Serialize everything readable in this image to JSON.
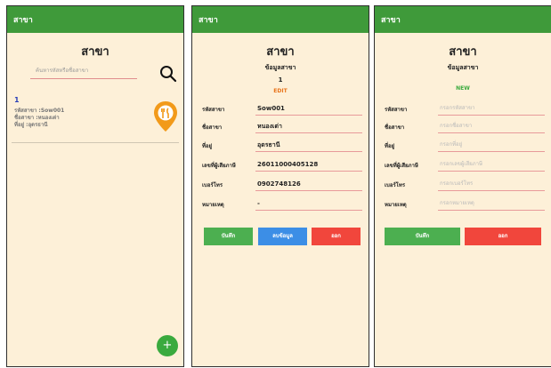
{
  "screen1": {
    "appbar_title": "สาขา",
    "title": "สาขา",
    "search_placeholder": "ค้นหารหัสหรือชื่อสาขา",
    "branches": [
      {
        "index": "1",
        "code_line": "รหัสสาขา :Sow001",
        "name_line": "ชื่อสาขา :หนองเต่า",
        "address_line": "ที่อยู่ :อุดรธานี"
      }
    ],
    "fab_label": "+"
  },
  "screen2": {
    "appbar_title": "สาขา",
    "title": "สาขา",
    "subtitle": "ข้อมูลสาขา",
    "page_number": "1",
    "mode": "EDIT",
    "fields": [
      {
        "label": "รหัสสาขา",
        "value": "Sow001"
      },
      {
        "label": "ชื่อสาขา",
        "value": "หนองเต่า"
      },
      {
        "label": "ที่อยู่",
        "value": "อุดรธานี"
      },
      {
        "label": "เลขที่ผู้เสียภาษี",
        "value": "26011000405128"
      },
      {
        "label": "เบอร์โทร",
        "value": "0902748126"
      },
      {
        "label": "หมายเหตุ",
        "value": "-"
      }
    ],
    "buttons": {
      "save": "บันทึก",
      "delete": "ลบข้อมูล",
      "exit": "ออก"
    }
  },
  "screen3": {
    "appbar_title": "สาขา",
    "title": "สาขา",
    "subtitle": "ข้อมูลสาขา",
    "mode": "NEW",
    "fields": [
      {
        "label": "รหัสสาขา",
        "placeholder": "กรอกรหัสสาขา"
      },
      {
        "label": "ชื่อสาขา",
        "placeholder": "กรอกชื่อสาขา"
      },
      {
        "label": "ที่อยู่",
        "placeholder": "กรอกที่อยู่"
      },
      {
        "label": "เลขที่ผู้เสียภาษี",
        "placeholder": "กรอกเลขผู้เสียภาษี"
      },
      {
        "label": "เบอร์โทร",
        "placeholder": "กรอกเบอร์โทร"
      },
      {
        "label": "หมายเหตุ",
        "placeholder": "กรอกหมายเหตุ"
      }
    ],
    "buttons": {
      "save": "บันทึก",
      "exit": "ออก"
    }
  },
  "colors": {
    "appbar": "#3f9a3a",
    "background": "#fdf0d8",
    "index": "#2a3fb8",
    "edit_mode": "#e8731a",
    "new_mode": "#3aaa3e",
    "pin": "#f29a1a",
    "green_button": "#4caf50",
    "blue_button": "#3c8ee6",
    "red_button": "#f1463c"
  },
  "icons": {
    "search": "search-icon",
    "restaurant_pin": "restaurant-pin-icon",
    "add": "plus-icon"
  }
}
